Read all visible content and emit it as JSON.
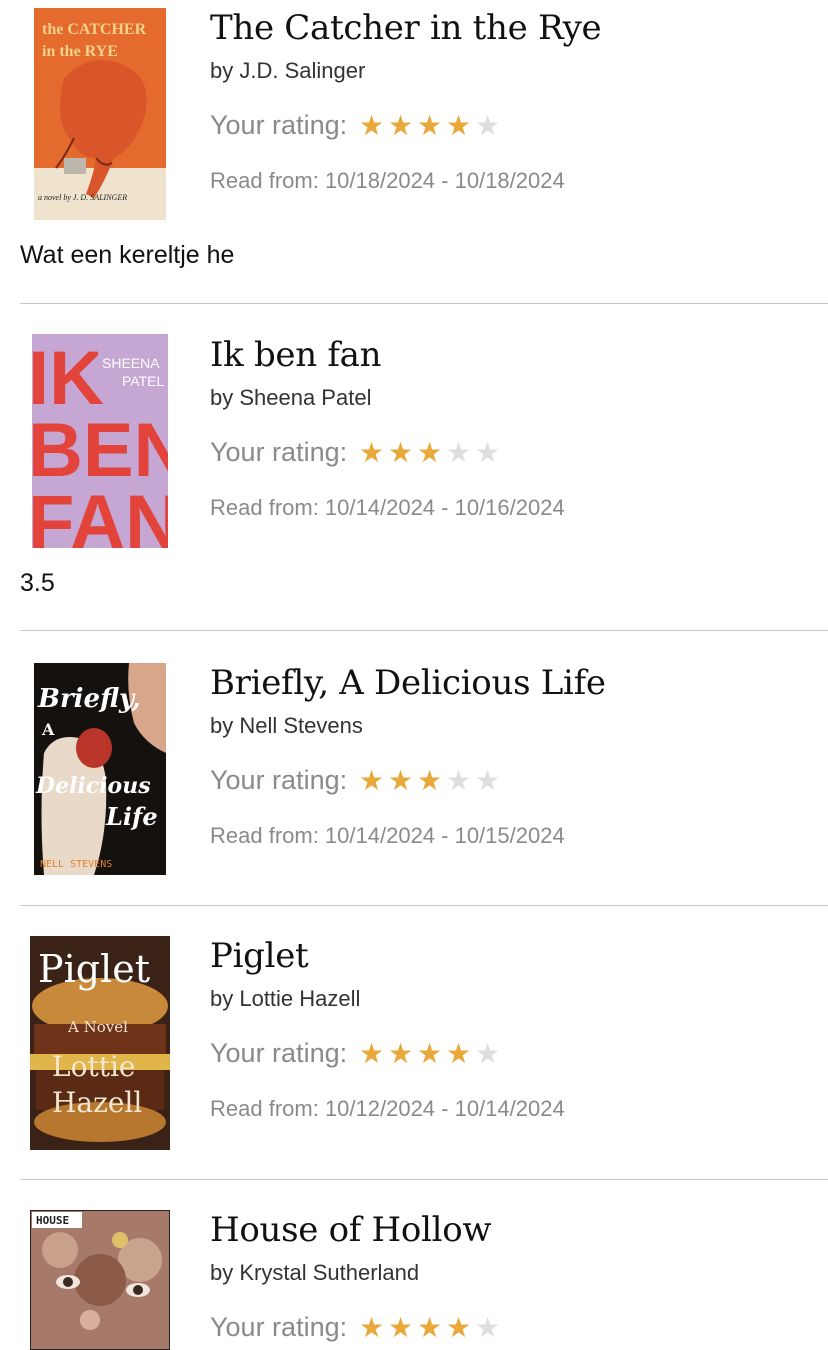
{
  "colors": {
    "star_filled": "#E9A93A",
    "star_empty": "#DEDEDE",
    "meta_text": "#8A8A8A",
    "divider": "#C8C8C8"
  },
  "labels": {
    "your_rating": "Your rating:",
    "read_from": "Read from:"
  },
  "books": [
    {
      "title": "The Catcher in the Rye",
      "author": "by J.D. Salinger",
      "rating": 4,
      "rating_max": 5,
      "read_start": "10/18/2024",
      "read_end": "10/18/2024",
      "review": "Wat een kereltje he",
      "cover": {
        "lines": [
          "the CATCHER",
          "in the RYE"
        ],
        "footer": "a novel by J. D. SALINGER",
        "icon": "carousel-horse-icon"
      }
    },
    {
      "title": "Ik ben fan",
      "author": "by Sheena Patel",
      "rating": 3,
      "rating_max": 5,
      "read_start": "10/14/2024",
      "read_end": "10/16/2024",
      "review": "3.5",
      "cover": {
        "lines": [
          "IK",
          "BEN",
          "FAN"
        ],
        "corner": [
          "SHEENA",
          "PATEL"
        ]
      }
    },
    {
      "title": "Briefly, A Delicious Life",
      "author": "by Nell Stevens",
      "rating": 3,
      "rating_max": 5,
      "read_start": "10/14/2024",
      "read_end": "10/15/2024",
      "review": "",
      "cover": {
        "lines": [
          "Briefly,",
          "A",
          "Delicious",
          "Life"
        ],
        "footer": "NELL STEVENS",
        "icon": "hand-holding-fruit-icon"
      }
    },
    {
      "title": "Piglet",
      "author": "by Lottie Hazell",
      "rating": 4,
      "rating_max": 5,
      "read_start": "10/12/2024",
      "read_end": "10/14/2024",
      "review": "",
      "cover": {
        "lines": [
          "Piglet",
          "A Novel",
          "Lottie",
          "Hazell"
        ],
        "icon": "burger-icon"
      }
    },
    {
      "title": "House of Hollow",
      "author": "by Krystal Sutherland",
      "rating": 4,
      "rating_max": 5,
      "read_start": "",
      "read_end": "",
      "review": "",
      "cover": {
        "lines": [
          "HOUSE"
        ],
        "icon": "flower-face-icon"
      }
    }
  ]
}
